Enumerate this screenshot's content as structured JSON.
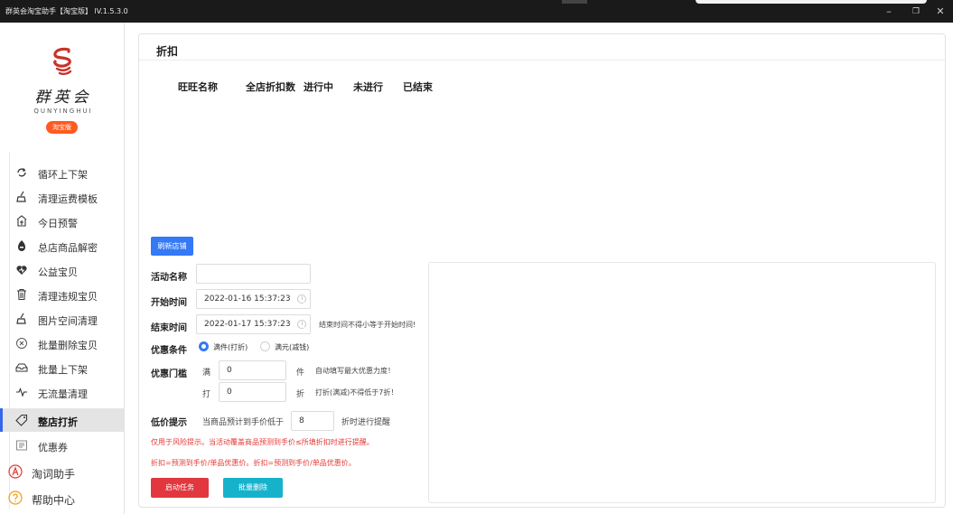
{
  "window": {
    "title": "群英会淘宝助手【淘宝版】 lV.1.5.3.0",
    "minimize": "–",
    "restore": "❐",
    "close": "✕"
  },
  "logo": {
    "cn_name": "群英会",
    "en_name": "QUNYINGHUI",
    "badge": "淘宝版",
    "brand_color": "#c8322a",
    "badge_color": "#ff5a1f"
  },
  "sidebar": {
    "items": [
      {
        "label": "循环上下架",
        "icon": "refresh-icon"
      },
      {
        "label": "清理运费模板",
        "icon": "broom-icon"
      },
      {
        "label": "今日预警",
        "icon": "alarm-icon"
      },
      {
        "label": "总店商品解密",
        "icon": "unlock-icon"
      },
      {
        "label": "公益宝贝",
        "icon": "heart-icon"
      },
      {
        "label": "清理违规宝贝",
        "icon": "trash-icon"
      },
      {
        "label": "图片空间清理",
        "icon": "image-clean-icon"
      },
      {
        "label": "批量删除宝贝",
        "icon": "delete-circle-icon"
      },
      {
        "label": "批量上下架",
        "icon": "shelf-icon"
      },
      {
        "label": "无流量清理",
        "icon": "traffic-icon"
      },
      {
        "label": "整店打折",
        "icon": "tag-icon",
        "active": true
      },
      {
        "label": "优惠券",
        "icon": "coupon-icon"
      }
    ],
    "sections": [
      {
        "label": "淘词助手",
        "icon": "keyword-icon"
      },
      {
        "label": "帮助中心",
        "icon": "help-icon"
      }
    ],
    "accent": "#3467e9"
  },
  "main": {
    "title": "折扣",
    "columns": [
      "旺旺名称",
      "全店折扣数",
      "进行中",
      "未进行",
      "已结束"
    ],
    "refresh_button": "刷新店铺",
    "form": {
      "activity_name_label": "活动名称",
      "activity_name_value": "",
      "start_label": "开始时间",
      "start_value": "2022-01-16 15:37:23",
      "end_label": "结束时间",
      "end_value": "2022-01-17 15:37:23",
      "end_hint": "结束时间不得小等于开始时间!",
      "condition_label": "优惠条件",
      "condition_options": [
        "满件(打折)",
        "满元(减钱)"
      ],
      "condition_selected": "满件(打折)",
      "threshold_label": "优惠门槛",
      "full_prefix": "满",
      "full_value": "0",
      "full_unit": "件",
      "full_hint": "自动填写最大优惠力度！",
      "discount_prefix": "打",
      "discount_value": "0",
      "discount_unit": "折",
      "discount_hint": "打折(满减)不得低于7折！",
      "low_price_label": "低价提示",
      "low_price_prefix": "当商品预计到手价低于",
      "low_price_value": "8",
      "low_price_suffix": "折时进行提醒",
      "note_1": "仅用于风险提示。当活动覆盖商品预测到手价≤所填折扣时进行提醒。",
      "note_2": "折扣=预测到手价/单品优惠价。折扣=预测到手价/单品优惠价。"
    },
    "start_button": "启动任务",
    "batch_delete_button": "批量删除",
    "colors": {
      "primary": "#3479f6",
      "danger": "#e2373f",
      "teal": "#16b2cc"
    }
  }
}
